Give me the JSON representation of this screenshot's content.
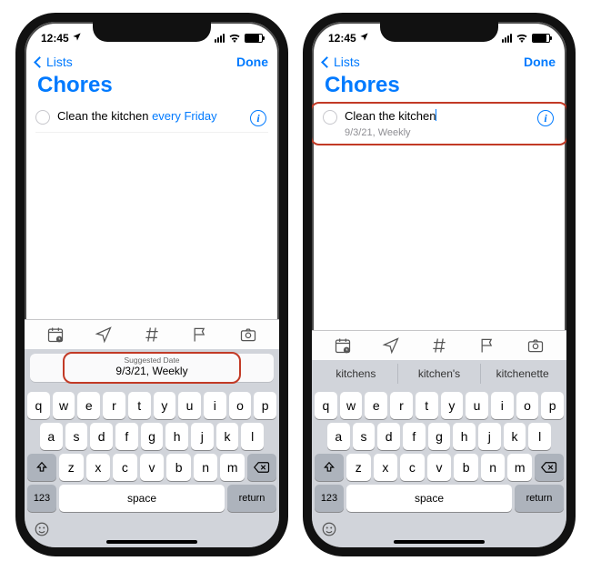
{
  "status": {
    "time": "12:45"
  },
  "nav": {
    "back": "Lists",
    "done": "Done"
  },
  "title": "Chores",
  "phoneA": {
    "reminder_text_plain": "Clean the kitchen ",
    "reminder_text_smart": "every Friday",
    "suggest_label": "Suggested Date",
    "suggest_value": "9/3/21, Weekly"
  },
  "phoneB": {
    "reminder_text_plain": "Clean the kitchen",
    "reminder_subtext": "9/3/21, Weekly",
    "predictions": [
      "kitchens",
      "kitchen's",
      "kitchenette"
    ]
  },
  "keyboard": {
    "row1": [
      "q",
      "w",
      "e",
      "r",
      "t",
      "y",
      "u",
      "i",
      "o",
      "p"
    ],
    "row2": [
      "a",
      "s",
      "d",
      "f",
      "g",
      "h",
      "j",
      "k",
      "l"
    ],
    "row3": [
      "z",
      "x",
      "c",
      "v",
      "b",
      "n",
      "m"
    ],
    "k123": "123",
    "space": "space",
    "return": "return"
  }
}
